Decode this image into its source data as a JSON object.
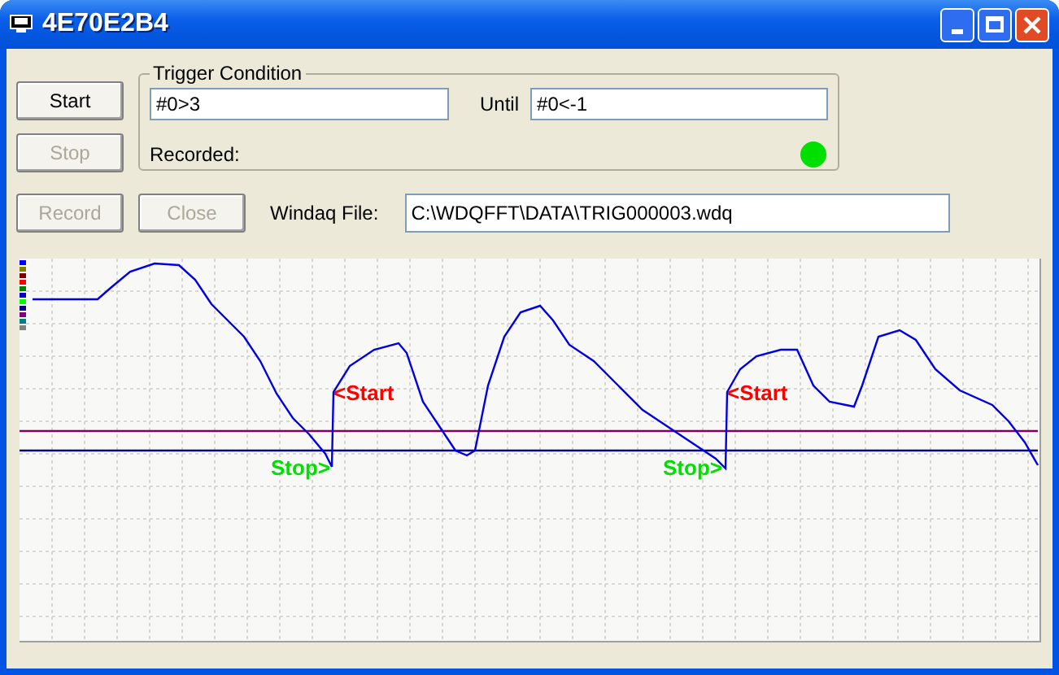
{
  "window": {
    "title": "4E70E2B4"
  },
  "trigger_condition": {
    "title": "Trigger Condition",
    "start_condition": "#0>3",
    "until_label": "Until",
    "stop_condition": "#0<-1",
    "recorded_label": "Recorded:",
    "recorded_indicator": {
      "color": "#00e000"
    }
  },
  "buttons": [
    {
      "label": "Start",
      "disabled": false
    },
    {
      "label": "Stop",
      "disabled": true
    },
    {
      "label": "Record",
      "disabled": true
    },
    {
      "label": "Close",
      "disabled": true
    }
  ],
  "windaq_file": {
    "label": "Windaq File:",
    "value": "C:\\WDQFFT\\DATA\\TRIG000003.wdq"
  },
  "chart": {
    "channel_indicators": [
      {
        "color": "#0000ff"
      },
      {
        "color": "#808000"
      },
      {
        "color": "#800000"
      },
      {
        "color": "#ff0000"
      },
      {
        "color": "#008000"
      },
      {
        "color": "#0000c0"
      },
      {
        "color": "#00ff00"
      },
      {
        "color": "#000080"
      },
      {
        "color": "#800080"
      },
      {
        "color": "#008080"
      },
      {
        "color": "#808080"
      }
    ],
    "markers": [
      {
        "kind": "stop",
        "label": "Stop>"
      },
      {
        "kind": "start",
        "label": "<Start"
      },
      {
        "kind": "stop",
        "label": "Stop>"
      },
      {
        "kind": "start",
        "label": "<Start"
      }
    ]
  }
}
